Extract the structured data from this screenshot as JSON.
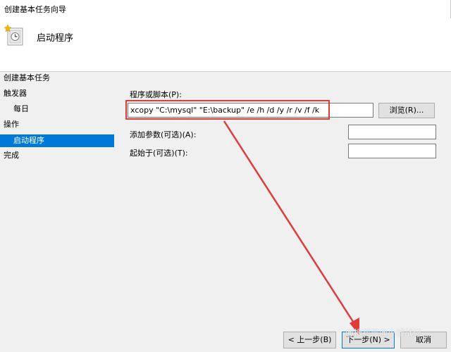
{
  "window": {
    "title": "创建基本任务向导"
  },
  "header": {
    "heading": "启动程序",
    "icon": "task-clock-icon"
  },
  "sidebar": {
    "items": [
      {
        "label": "创建基本任务"
      },
      {
        "label": "触发器"
      },
      {
        "label": "每日"
      },
      {
        "label": "操作"
      },
      {
        "label": "启动程序"
      },
      {
        "label": "完成"
      }
    ]
  },
  "form": {
    "program_label": "程序或脚本(P):",
    "program_value": "xcopy \"C:\\mysql\" \"E:\\backup\" /e /h /d /y /r /v /f /k",
    "browse_label": "浏览(R)...",
    "args_label": "添加参数(可选)(A):",
    "args_value": "",
    "start_label": "起始于(可选)(T):",
    "start_value": ""
  },
  "footer": {
    "back_label": "< 上一步(B)",
    "next_label": "下一步(N) >",
    "cancel_label": "取消"
  },
  "overlay": {
    "watermark": "@搜狐号@小城战记"
  },
  "colors": {
    "selection": "#0078d7",
    "annotation": "#e03b3b",
    "panel": "#f0f0f0"
  }
}
